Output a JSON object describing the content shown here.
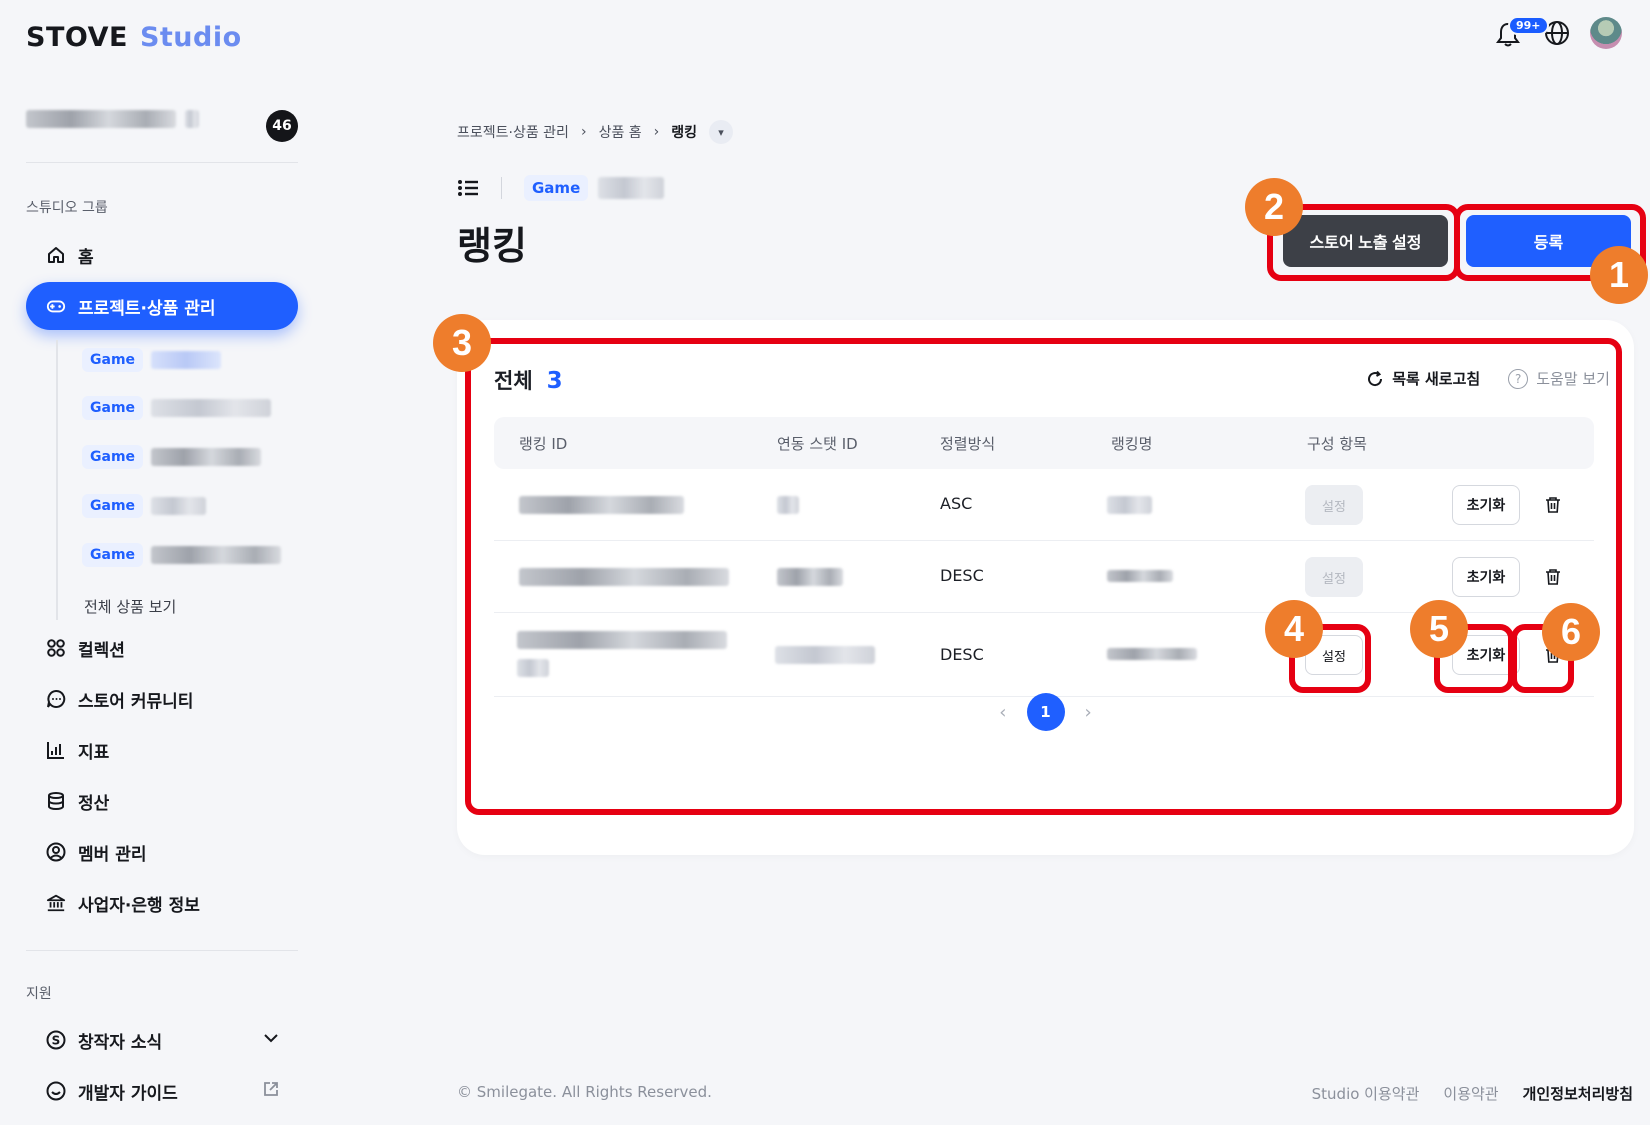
{
  "header": {
    "logo_brand": "STOVE",
    "logo_studio": "Studio",
    "notification_count": "99+",
    "icons": [
      "bell-icon",
      "globe-icon",
      "avatar"
    ]
  },
  "sidebar": {
    "project_count": "46",
    "section_studio": "스튜디오 그룹",
    "nav_home": "홈",
    "nav_project": "프로젝트·상품 관리",
    "game_tag": "Game",
    "sub_all": "전체 상품 보기",
    "nav_collection": "컬렉션",
    "nav_community": "스토어 커뮤니티",
    "nav_metrics": "지표",
    "nav_settlement": "정산",
    "nav_members": "멤버 관리",
    "nav_business": "사업자·은행 정보",
    "section_support": "지원",
    "nav_news": "창작자 소식",
    "nav_guide": "개발자 가이드"
  },
  "breadcrumb": {
    "items": [
      "프로젝트·상품 관리",
      "상품 홈",
      "랭킹"
    ]
  },
  "page": {
    "game_tag": "Game",
    "title": "랭킹",
    "btn_store": "스토어 노출 설정",
    "btn_register": "등록"
  },
  "list": {
    "total_label": "전체",
    "total_count": "3",
    "refresh": "목록 새로고침",
    "help": "도움말 보기",
    "columns": [
      "랭킹 ID",
      "연동 스탯 ID",
      "정렬방식",
      "랭킹명",
      "구성 항목"
    ],
    "rows": [
      {
        "sort": "ASC",
        "set_label": "설정",
        "set_state": "disabled",
        "reset_label": "초기화"
      },
      {
        "sort": "DESC",
        "set_label": "설정",
        "set_state": "disabled",
        "reset_label": "초기화"
      },
      {
        "sort": "DESC",
        "set_label": "설정",
        "set_state": "enabled",
        "reset_label": "초기화"
      }
    ],
    "page_current": "1"
  },
  "annotations": [
    "1",
    "2",
    "3",
    "4",
    "5",
    "6"
  ],
  "colors": {
    "accent": "#1f5fff",
    "highlight": "#e60012",
    "marker": "#ee7d2c"
  },
  "footer": {
    "copyright": "© Smilegate. All Rights Reserved.",
    "links": [
      "Studio 이용약관",
      "이용약관",
      "개인정보처리방침"
    ]
  }
}
